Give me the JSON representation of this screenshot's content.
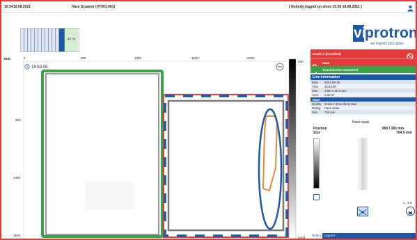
{
  "header": {
    "time": "15:54",
    "date": "19.08.2021",
    "app_title": "Haze Scanner (VT001-001)",
    "login_status": "[ Nobody logged on since 15:59 18.08.2021 ]"
  },
  "progress": {
    "label": "47 %",
    "fraction": 0.47
  },
  "logo": {
    "text_vi": "vi",
    "text_rest": "protron",
    "tagline": "we inspect your glass"
  },
  "chart": {
    "x_unit": "mm",
    "x_ticks": [
      "0",
      "500",
      "1000",
      "1500",
      "2000"
    ],
    "y_ticks": [
      "500",
      "1000",
      "1500"
    ],
    "timestamp": "15:53:05",
    "scale_top": "bad",
    "scale_bottom": "good"
  },
  "grade_panel": {
    "title": "Grade A (Excellent)",
    "status_red": "Haze",
    "status_green": "Transmission measured"
  },
  "line_info": {
    "title": "Line information",
    "rows": [
      {
        "key": "Date",
        "value": "2021-08-19"
      },
      {
        "key": "Time",
        "value": "15:53:05"
      },
      {
        "key": "Size",
        "value": "1060 x 1170 mm"
      },
      {
        "key": "Area",
        "value": "1.22 m²"
      }
    ],
    "haze_title": "Haze",
    "haze_rows": [
      {
        "key": "Quality",
        "value": "Grade A (Excellent) Bad"
      },
      {
        "key": "Rating",
        "value": "Haze weak"
      },
      {
        "key": "Size",
        "value": "705 mm"
      }
    ]
  },
  "detail": {
    "title": "Haze weak",
    "position_label": "Position",
    "position_value": "894 / 383 mm",
    "size_label": "Size",
    "size_value": "704.5 mm",
    "zoom": "1 : 2.5"
  },
  "tabs": [
    "Defect",
    "Legend"
  ],
  "colors": {
    "frame_red": "#e23b3b",
    "brand_blue": "#1c58a7",
    "green": "#3aa34a",
    "grey_outline": "#7a7a7a"
  },
  "icons": [
    "user-icon",
    "no-entry-icon",
    "check-icon",
    "clock-icon",
    "more-icon",
    "fit-icon",
    "save-icon"
  ]
}
